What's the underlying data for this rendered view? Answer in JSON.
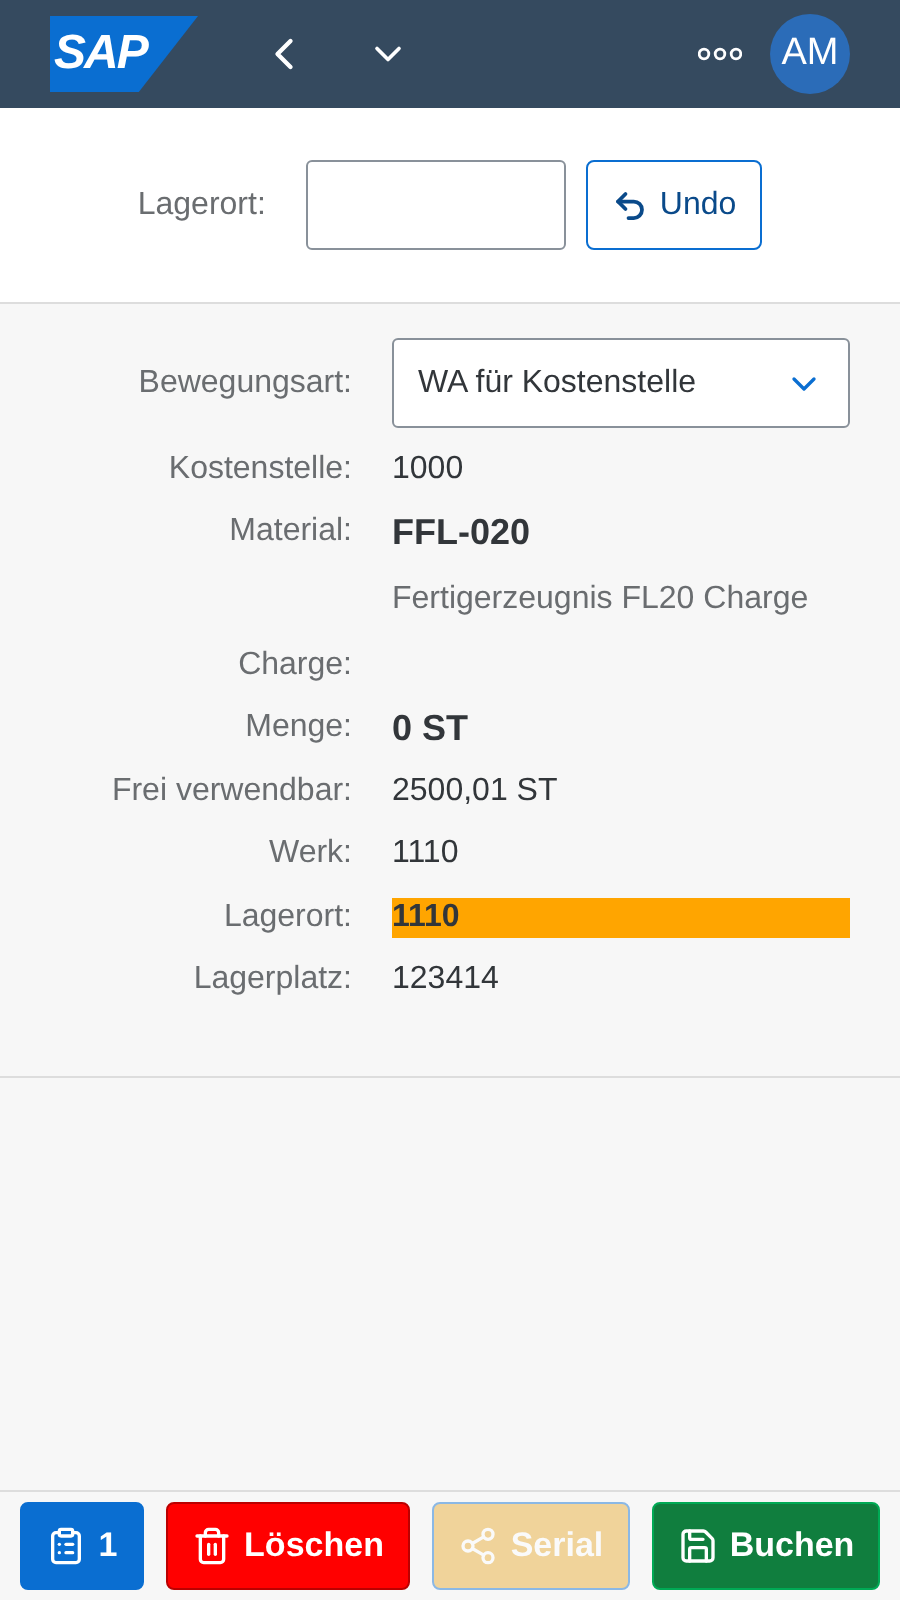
{
  "header": {
    "logo": "SAP",
    "avatar": "AM"
  },
  "top": {
    "label": "Lagerort:",
    "undo": "Undo"
  },
  "movement": {
    "label": "Bewegungsart:",
    "value": "WA für Kostenstelle"
  },
  "rows": [
    {
      "kind": "field",
      "label": "Kostenstelle:",
      "value": "1000",
      "bold": false,
      "highlighted": false
    },
    {
      "kind": "field",
      "label": "Material:",
      "value": "FFL-020",
      "bold": true,
      "highlighted": false
    },
    {
      "kind": "description",
      "value": "Fertigerzeugnis FL20 Charge"
    },
    {
      "kind": "field",
      "label": "Charge:"
    },
    {
      "kind": "field",
      "label": "Menge:",
      "value": "0 ST",
      "bold": true,
      "highlighted": false
    },
    {
      "kind": "field",
      "label": "Frei verwendbar:",
      "value": "2500,01 ST",
      "bold": false,
      "highlighted": false
    },
    {
      "kind": "field",
      "label": "Werk:",
      "value": "1110",
      "bold": false,
      "highlighted": false
    },
    {
      "kind": "field",
      "label": "Lagerort:",
      "value": "1110",
      "bold": true,
      "highlighted": true
    },
    {
      "kind": "field",
      "label": "Lagerplatz:",
      "value": "123414",
      "bold": false,
      "highlighted": false
    }
  ],
  "footer": [
    {
      "kind": "count",
      "label": "1",
      "disabled": false
    },
    {
      "kind": "delete",
      "label": "Löschen",
      "disabled": false
    },
    {
      "kind": "serial",
      "label": "Serial",
      "disabled": true
    },
    {
      "kind": "save",
      "label": "Buchen",
      "disabled": false
    }
  ]
}
